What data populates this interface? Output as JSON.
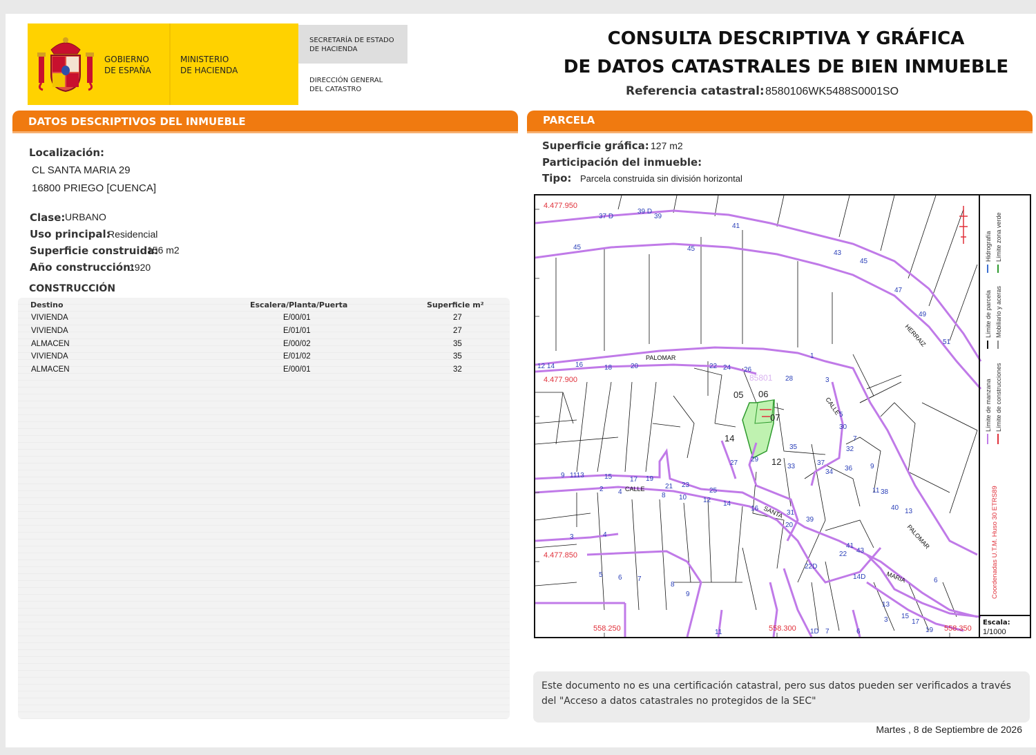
{
  "header": {
    "gobierno": "GOBIERNO\nDE ESPAÑA",
    "ministerio": "MINISTERIO\nDE HACIENDA",
    "secretaria": "SECRETARÍA DE ESTADO\nDE HACIENDA",
    "direccion": "DIRECCIÓN GENERAL\nDEL CATASTRO",
    "title": "CONSULTA DESCRIPTIVA Y GRÁFICA\nDE DATOS CATASTRALES DE BIEN INMUEBLE",
    "ref_label": "Referencia catastral:",
    "ref_value": "8580106WK5488S0001SO"
  },
  "left": {
    "section_title": "DATOS DESCRIPTIVOS DEL INMUEBLE",
    "localizacion_label": "Localización:",
    "address_line1": "CL SANTA MARIA 29",
    "address_line2": "16800 PRIEGO [CUENCA]",
    "clase_label": "Clase:",
    "clase_value": "URBANO",
    "uso_label": "Uso principal:",
    "uso_value": "Residencial",
    "sup_label": "Superficie construida:",
    "sup_value": "156 m2",
    "anio_label": "Año construcción:",
    "anio_value": "1920",
    "construccion_title": "CONSTRUCCIÓN",
    "table": {
      "headers": [
        "Destino",
        "Escalera/Planta/Puerta",
        "Superficie m²"
      ],
      "rows": [
        [
          "VIVIENDA",
          "E/00/01",
          "27"
        ],
        [
          "VIVIENDA",
          "E/01/01",
          "27"
        ],
        [
          "ALMACEN",
          "E/00/02",
          "35"
        ],
        [
          "VIVIENDA",
          "E/01/02",
          "35"
        ],
        [
          "ALMACEN",
          "E/00/01",
          "32"
        ]
      ]
    }
  },
  "right": {
    "section_title": "PARCELA",
    "sup_grafica_label": "Superficie gráfica:",
    "sup_grafica_value": "127 m2",
    "participacion_label": "Participación del inmueble:",
    "tipo_label": "Tipo:",
    "tipo_value": "Parcela construida sin división horizontal"
  },
  "map": {
    "coords_y": [
      "4.477.950",
      "4.477.900",
      "4.477.850"
    ],
    "coords_x": [
      "558.250",
      "558.300",
      "558.350"
    ],
    "parcel_label": "85801",
    "parcel_numbers": [
      "05",
      "06",
      "07",
      "14",
      "12"
    ],
    "street_names": [
      "PALOMAR",
      "CALLE",
      "SANTA",
      "PALOMAR",
      "MARIA",
      "HERRAIZ",
      "CALLE"
    ],
    "house_numbers": [
      "37 D",
      "39 D",
      "39",
      "41",
      "45",
      "45",
      "43",
      "45",
      "47",
      "49",
      "51",
      "12 14",
      "16",
      "18",
      "20",
      "22",
      "24",
      "26",
      "28",
      "1",
      "3",
      "5",
      "7",
      "9",
      "30",
      "32",
      "34",
      "36",
      "38",
      "40",
      "11",
      "13",
      "9",
      "1113",
      "15",
      "17",
      "19",
      "21",
      "23",
      "25",
      "27",
      "29",
      "31",
      "33",
      "35",
      "37",
      "2",
      "4",
      "6",
      "8",
      "10",
      "12",
      "14",
      "16",
      "20",
      "22",
      "3",
      "4",
      "5",
      "6",
      "7",
      "8",
      "9",
      "11",
      "41",
      "43",
      "22D",
      "14D",
      "15",
      "17",
      "19",
      "13",
      "6"
    ],
    "legend": [
      "Límite de manzana",
      "Límite de parcela",
      "Límite de construcciones",
      "Mobiliario y aceras",
      "Hidrografía",
      "Límite zona verde"
    ],
    "coord_system": "Coordenadas U.T.M. Huso 30 ETRS89",
    "scale_label": "Escala:",
    "scale_value": "1/1000",
    "colors": {
      "block": "#c07ae8",
      "parcel_fill": "#bff2b0",
      "coord_text": "#e0303a",
      "label_blue": "#2a3fb8"
    }
  },
  "footer": {
    "note": "Este documento no es una certificación catastral, pero sus datos pueden ser verificados a través del \"Acceso a datos catastrales no protegidos de la SEC\"",
    "date": "Martes , 8 de Septiembre de 2026"
  }
}
